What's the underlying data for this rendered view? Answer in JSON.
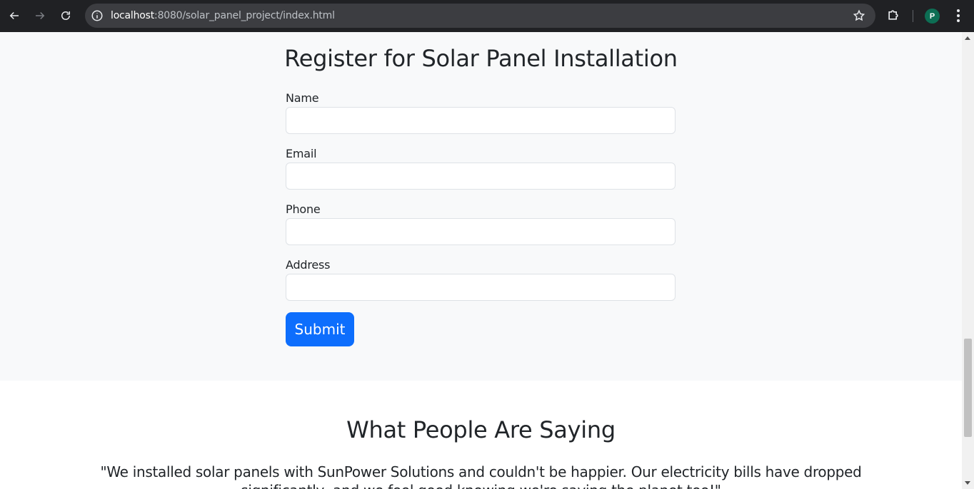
{
  "browser": {
    "url_host": "localhost",
    "url_path": ":8080/solar_panel_project/index.html",
    "profile_initial": "P"
  },
  "register": {
    "title": "Register for Solar Panel Installation",
    "fields": [
      {
        "label": "Name",
        "value": "",
        "placeholder": ""
      },
      {
        "label": "Email",
        "value": "",
        "placeholder": ""
      },
      {
        "label": "Phone",
        "value": "",
        "placeholder": ""
      },
      {
        "label": "Address",
        "value": "",
        "placeholder": ""
      }
    ],
    "submit_label": "Submit"
  },
  "testimonials": {
    "title": "What People Are Saying",
    "quote": "\"We installed solar panels with SunPower Solutions and couldn't be happier. Our electricity bills have dropped significantly, and we feel good knowing we're saving the planet too!\""
  },
  "colors": {
    "primary": "#0d6efd",
    "section_bg": "#f8f9fa",
    "text": "#212529"
  }
}
